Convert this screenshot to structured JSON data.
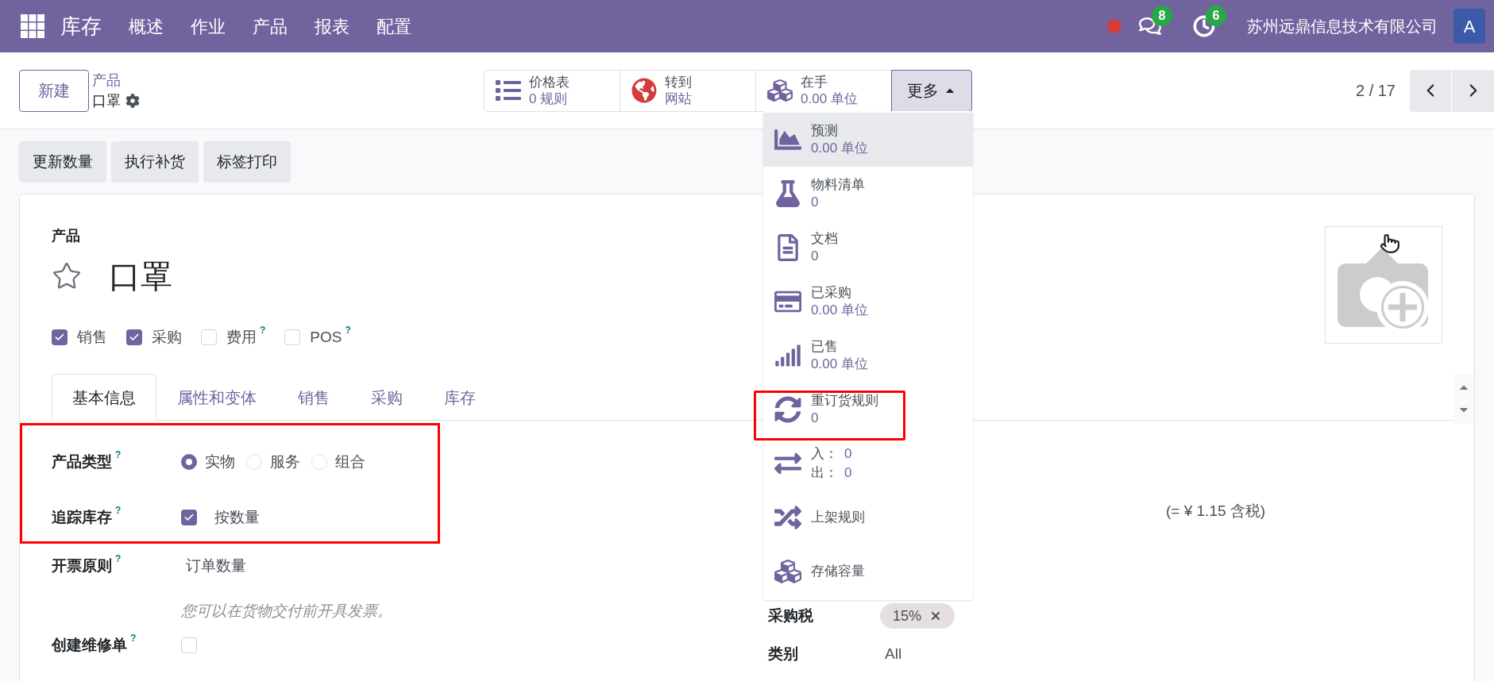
{
  "navbar": {
    "app": "库存",
    "menu": [
      "概述",
      "作业",
      "产品",
      "报表",
      "配置"
    ],
    "chat_count": "8",
    "activity_count": "6",
    "company": "苏州远鼎信息技术有限公司",
    "avatar": "A"
  },
  "control_panel": {
    "new_button": "新建",
    "breadcrumb": "产品",
    "record": "口罩",
    "stat_buttons": [
      {
        "kind": "pricelist",
        "title": "价格表",
        "value": "0 规则"
      },
      {
        "kind": "website",
        "title": "转到",
        "value": "网站"
      },
      {
        "kind": "onhand",
        "title": "在手",
        "value": "0.00 单位"
      }
    ],
    "more_button": {
      "label": "更多",
      "expanded": true
    },
    "pager": "2 / 17"
  },
  "more_menu": [
    {
      "kind": "forecast",
      "title": "预测",
      "value": "0.00 单位",
      "highlighted": true,
      "annotated": false
    },
    {
      "kind": "bom",
      "title": "物料清单",
      "value": "0",
      "highlighted": false,
      "annotated": false
    },
    {
      "kind": "documents",
      "title": "文档",
      "value": "0",
      "highlighted": false,
      "annotated": false
    },
    {
      "kind": "purchased",
      "title": "已采购",
      "value": "0.00 单位",
      "highlighted": false,
      "annotated": false
    },
    {
      "kind": "sold",
      "title": "已售",
      "value": "0.00 单位",
      "highlighted": false,
      "annotated": false
    },
    {
      "kind": "reorder",
      "title": "重订货规则",
      "value": "0",
      "highlighted": false,
      "annotated": true
    },
    {
      "kind": "moves",
      "lines": [
        {
          "label": "入：",
          "value": "0"
        },
        {
          "label": "出：",
          "value": "0"
        }
      ],
      "highlighted": false,
      "annotated": false
    },
    {
      "kind": "putaway",
      "title": "上架规则",
      "highlighted": false,
      "annotated": false
    },
    {
      "kind": "storage",
      "title": "存储容量",
      "highlighted": false,
      "annotated": false
    }
  ],
  "actions": [
    "更新数量",
    "执行补货",
    "标签打印"
  ],
  "form": {
    "label": "产品",
    "name": "口罩",
    "favorite": false,
    "options": [
      {
        "label": "销售",
        "checked": true
      },
      {
        "label": "采购",
        "checked": true
      },
      {
        "label": "费用",
        "checked": false,
        "help": "?"
      },
      {
        "label": "POS",
        "checked": false,
        "help": "?"
      }
    ],
    "tabs": [
      {
        "label": "基本信息",
        "selected": true
      },
      {
        "label": "属性和变体",
        "selected": false
      },
      {
        "label": "销售",
        "selected": false
      },
      {
        "label": "采购",
        "selected": false
      },
      {
        "label": "库存",
        "selected": false
      }
    ],
    "fields": [
      {
        "kind": "radio",
        "label": "产品类型",
        "help": "?",
        "annotated": true,
        "options": [
          {
            "label": "实物",
            "selected": true
          },
          {
            "label": "服务",
            "selected": false
          },
          {
            "label": "组合",
            "selected": false
          }
        ]
      },
      {
        "kind": "checkbox",
        "label": "追踪库存",
        "help": "?",
        "annotated": true,
        "checked": true,
        "text": "按数量"
      },
      {
        "kind": "text",
        "label": "开票原则",
        "help": "?",
        "annotated": false,
        "value": "订单数量",
        "note": "您可以在货物交付前开具发票。"
      },
      {
        "kind": "checkbox",
        "label": "创建维修单",
        "help": "?",
        "annotated": false,
        "checked": false
      }
    ],
    "price_note": "(= ¥ 1.15 含税)",
    "right_fields": [
      {
        "kind": "tags",
        "label": "采购税",
        "tags": [
          "15%"
        ]
      },
      {
        "kind": "text",
        "label": "类别",
        "value": "All"
      }
    ]
  }
}
